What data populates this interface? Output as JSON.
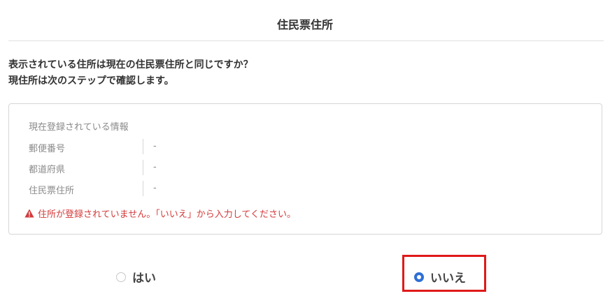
{
  "page": {
    "title": "住民票住所"
  },
  "question": {
    "line1": "表示されている住所は現在の住民票住所と同じですか？",
    "line2": "現住所は次のステップで確認します。"
  },
  "info": {
    "heading": "現在登録されている情報",
    "rows": [
      {
        "label": "郵便番号",
        "value": "-"
      },
      {
        "label": "都道府県",
        "value": "-"
      },
      {
        "label": "住民票住所",
        "value": "-"
      }
    ],
    "warning": "住所が登録されていません。「いいえ」から入力してください。"
  },
  "options": {
    "yes": {
      "label": "はい",
      "selected": false
    },
    "no": {
      "label": "いいえ",
      "selected": true
    }
  },
  "colors": {
    "accent": "#2f6fd6",
    "warning": "#d33b3b",
    "highlight": "#e01919"
  },
  "icons": {
    "warning": "warning-triangle-icon"
  }
}
